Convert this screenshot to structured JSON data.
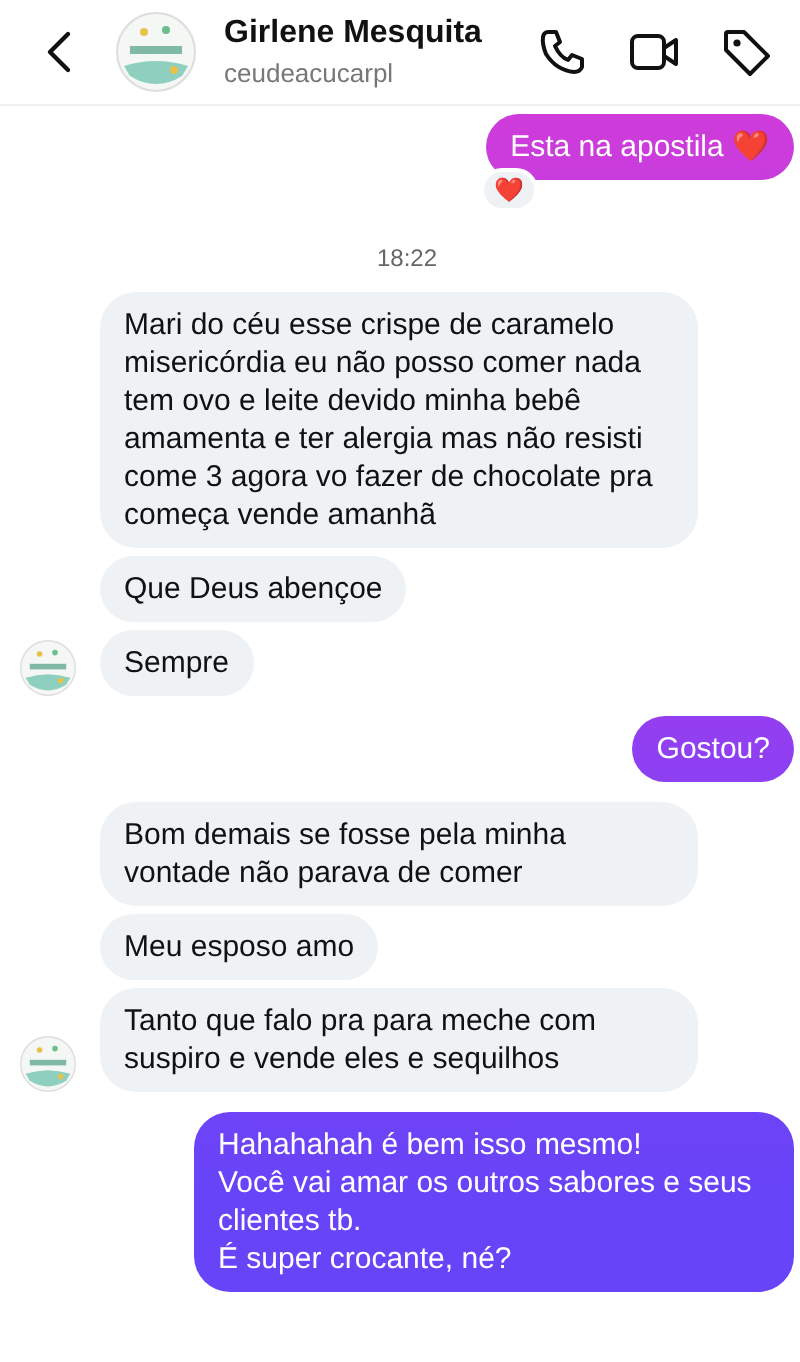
{
  "header": {
    "name": "Girlene Mesquita",
    "username": "ceudeacucarpl"
  },
  "messages": [
    {
      "kind": "outgoing",
      "text": "Esta na apostila ❤️",
      "reaction": "❤️"
    },
    {
      "kind": "time",
      "text": "18:22"
    },
    {
      "kind": "incoming",
      "text": "Mari do céu esse crispe de caramelo misericórdia eu não posso comer nada tem ovo e leite devido minha bebê amamenta e ter alergia mas não resisti come 3 agora vo fazer de chocolate pra começa vende amanhã",
      "show_avatar": false
    },
    {
      "kind": "incoming",
      "text": "Que Deus abençoe",
      "show_avatar": false
    },
    {
      "kind": "incoming",
      "text": "Sempre",
      "show_avatar": true
    },
    {
      "kind": "outgoing",
      "text": "Gostou?"
    },
    {
      "kind": "incoming",
      "text": "Bom demais se fosse pela minha vontade não parava de comer",
      "show_avatar": false
    },
    {
      "kind": "incoming",
      "text": "Meu esposo amo",
      "show_avatar": false
    },
    {
      "kind": "incoming",
      "text": "Tanto que falo pra para meche com suspiro e vende eles e sequilhos",
      "show_avatar": true
    },
    {
      "kind": "outgoing",
      "text": "Hahahahah é bem isso mesmo!\nVocê vai amar os outros sabores e seus clientes tb.\nÉ super crocante, né?"
    }
  ]
}
